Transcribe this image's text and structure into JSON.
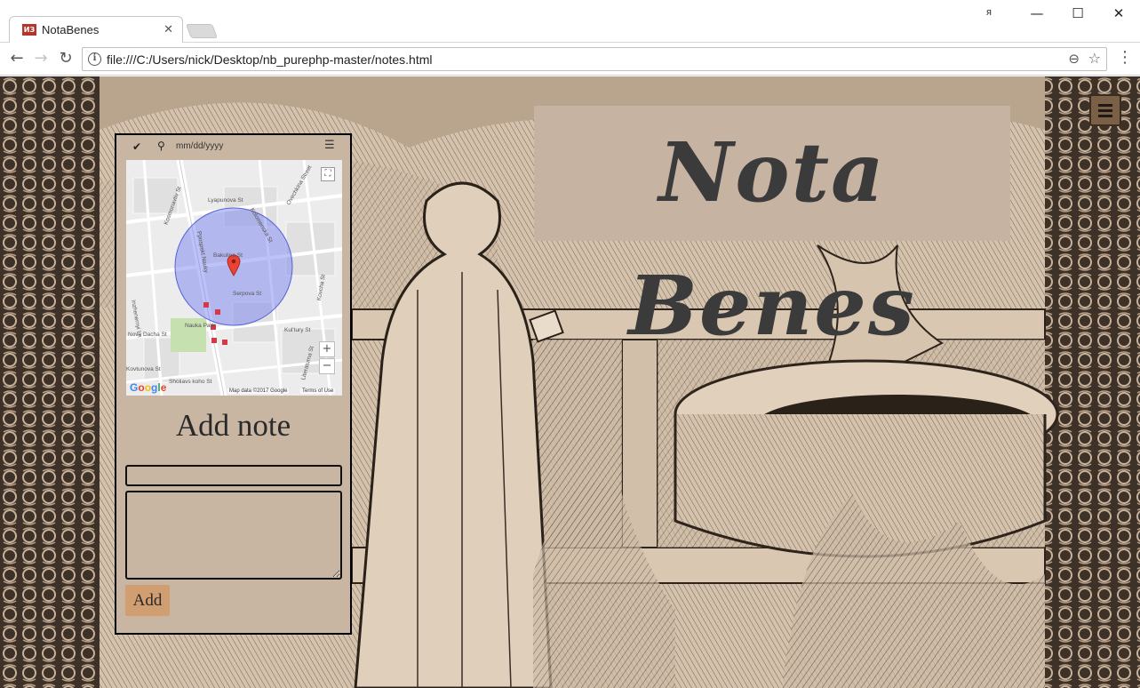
{
  "browser": {
    "tab_title": "NotaBenes",
    "tab_favicon_text": "ИЗ",
    "tab_close": "✕",
    "url": "file:///C:/Users/nick/Desktop/nb_purephp-master/notes.html",
    "user_glyph": "я",
    "window_min": "—",
    "window_max": "☐",
    "window_close": "✕",
    "back_glyph": "←",
    "forward_glyph": "→",
    "reload_glyph": "↻",
    "info_glyph": "i",
    "zoom_glyph": "⊖",
    "star_glyph": "☆",
    "menu_glyph": "⋮"
  },
  "page": {
    "title": "Nota Benes",
    "background_color": "#c9b6a2",
    "accent_color": "#d19e72"
  },
  "panel": {
    "check_glyph": "✔",
    "pin_glyph": "⚲",
    "date_placeholder": "mm/dd/yyyy",
    "menu_glyph": "☰",
    "heading": "Add note",
    "add_label": "Add",
    "title_value": "",
    "body_value": ""
  },
  "map": {
    "streets": [
      "Kosmonavtiv St",
      "Lyapunova St",
      "Kolomenska St",
      "Ovechkina Street",
      "Bakulina St",
      "Serpova St",
      "Kul'tury St",
      "Inzhenernyi Ln",
      "Nova Dacha St",
      "Sholiavs koho St",
      "Literaturna St",
      "Kovcha St",
      "Ppospekt Nauky",
      "Kovtunova St",
      "Nauka Park"
    ],
    "fullscreen_glyph": "⛶",
    "zoom_in": "+",
    "zoom_out": "−",
    "logo": "Google",
    "attribution": "Map data ©2017 Google",
    "terms": "Terms of Use"
  }
}
